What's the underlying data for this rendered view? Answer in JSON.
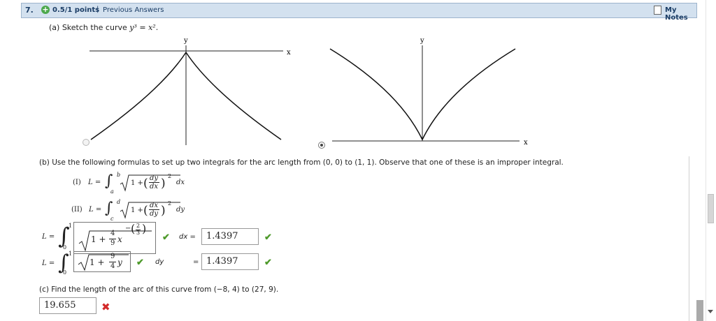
{
  "header": {
    "question_number": "7.",
    "points": "0.5/1 points",
    "separator": "|",
    "previous_answers": "Previous Answers",
    "my_notes": "My Notes"
  },
  "part_a": {
    "prompt": "(a) Sketch the curve",
    "equation": "y³ = x².",
    "graph1": {
      "y_label": "y",
      "x_label": "x",
      "selected": false
    },
    "graph2": {
      "y_label": "y",
      "x_label": "x",
      "selected": true
    }
  },
  "part_b": {
    "prompt": "(b) Use the following formulas to set up two integrals for the arc length from (0, 0) to (1, 1). Observe that one of these is an improper integral.",
    "formula1": {
      "label": "(I)",
      "lhs": "L =",
      "lower": "a",
      "upper": "b",
      "one_plus": "1 +",
      "num": "dy",
      "den": "dx",
      "power": "2",
      "diff": "dx"
    },
    "formula2": {
      "label": "(II)",
      "lhs": "L =",
      "lower": "c",
      "upper": "d",
      "one_plus": "1 +",
      "num": "dx",
      "den": "dy",
      "power": "2",
      "diff": "dy"
    },
    "integral1": {
      "lhs": "L =",
      "lower": "0",
      "upper": "1",
      "one_plus": "1 +",
      "coef_num": "4",
      "coef_den": "9",
      "var": "x",
      "exp_sign": "−",
      "exp_num": "2",
      "exp_den": "3",
      "diff": "dx =",
      "answer": "1.4397"
    },
    "integral2": {
      "lhs": "L =",
      "lower": "0",
      "upper": "1",
      "one_plus": "1 +",
      "coef_num": "9",
      "coef_den": "4",
      "var": "y",
      "diff": "dy",
      "eq": "=",
      "answer": "1.4397"
    }
  },
  "part_c": {
    "prompt": "(c) Find the length of the arc of this curve from",
    "points_text": "(−8, 4) to (27, 9).",
    "answer": "19.655"
  },
  "icons": {
    "check": "✔",
    "cross": "✖",
    "plus": "+"
  },
  "colors": {
    "header_bg": "#d3e1ef",
    "header_text": "#1b3d66",
    "check": "#4e9a2b",
    "cross": "#d32a2a"
  }
}
